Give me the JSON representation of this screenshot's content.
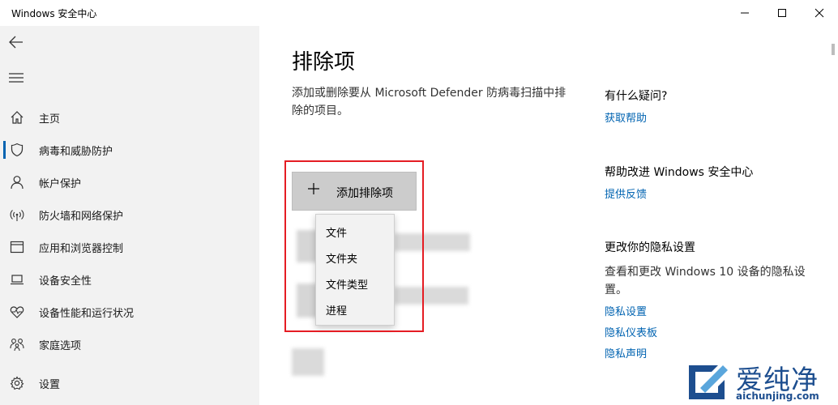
{
  "window": {
    "title": "Windows 安全中心"
  },
  "sidebar": {
    "items": [
      {
        "label": "主页",
        "icon": "home-icon"
      },
      {
        "label": "病毒和威胁防护",
        "icon": "shield-icon",
        "selected": true
      },
      {
        "label": "帐户保护",
        "icon": "person-icon"
      },
      {
        "label": "防火墙和网络保护",
        "icon": "wireless-icon"
      },
      {
        "label": "应用和浏览器控制",
        "icon": "app-window-icon"
      },
      {
        "label": "设备安全性",
        "icon": "laptop-icon"
      },
      {
        "label": "设备性能和运行状况",
        "icon": "heart-pulse-icon"
      },
      {
        "label": "家庭选项",
        "icon": "family-icon"
      }
    ],
    "settings_label": "设置"
  },
  "main": {
    "title": "排除项",
    "description": "添加或删除要从 Microsoft Defender 防病毒扫描中排除的项目。",
    "add_button_label": "添加排除项",
    "menu_items": [
      "文件",
      "文件夹",
      "文件类型",
      "进程"
    ]
  },
  "right": {
    "question_heading": "有什么疑问?",
    "get_help": "获取帮助",
    "improve_heading": "帮助改进 Windows 安全中心",
    "feedback": "提供反馈",
    "privacy_heading": "更改你的隐私设置",
    "privacy_text": "查看和更改 Windows 10 设备的隐私设置。",
    "privacy_links": [
      "隐私设置",
      "隐私仪表板",
      "隐私声明"
    ]
  },
  "watermark": {
    "text": "爱纯净",
    "url": "aichunjing.com"
  },
  "colors": {
    "accent": "#0063b1",
    "highlight": "#e51c23",
    "sidebar_bg": "#f2f2f2"
  }
}
